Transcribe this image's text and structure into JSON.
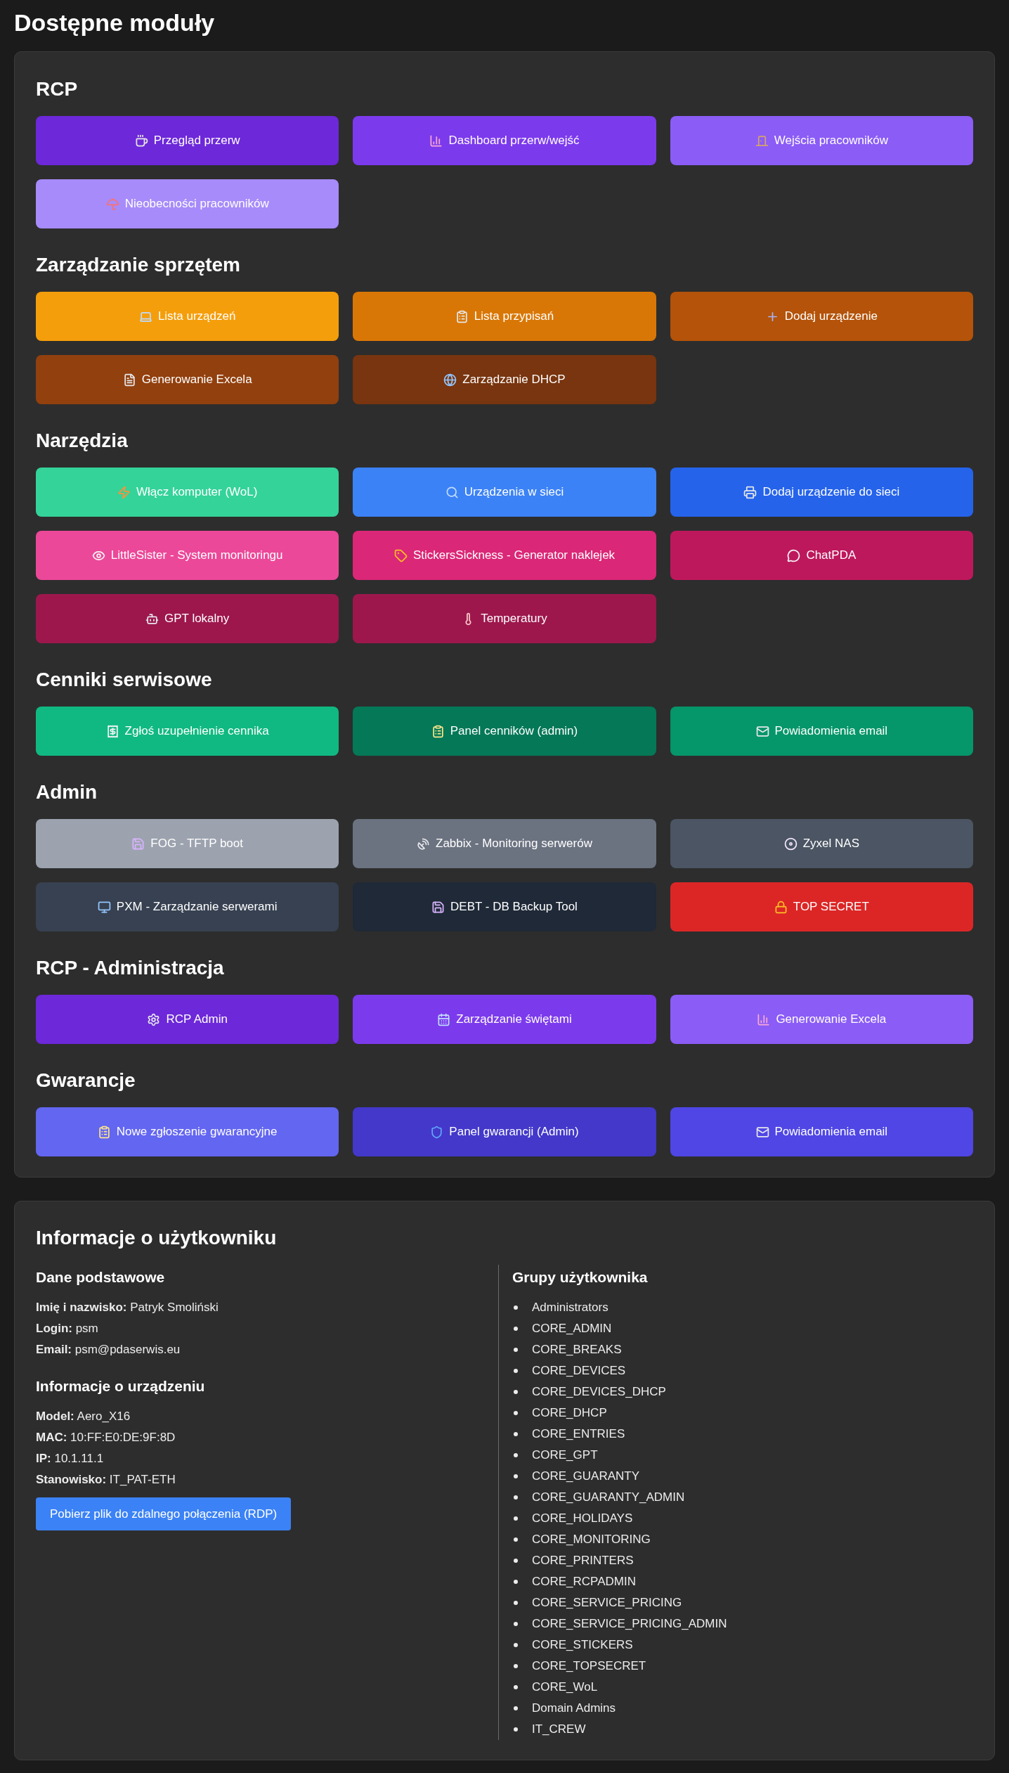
{
  "page_title": "Dostępne moduły",
  "sections": [
    {
      "title": "RCP",
      "buttons": [
        {
          "label": "Przegląd przerw",
          "color": "#6d28d9"
        },
        {
          "label": "Dashboard przerw/wejść",
          "color": "#7c3aed"
        },
        {
          "label": "Wejścia pracowników",
          "color": "#8b5cf6"
        },
        {
          "label": "Nieobecności pracowników",
          "color": "#a78bfa"
        }
      ]
    },
    {
      "title": "Zarządzanie sprzętem",
      "buttons": [
        {
          "label": "Lista urządzeń",
          "color": "#f59e0b"
        },
        {
          "label": "Lista przypisań",
          "color": "#d97706"
        },
        {
          "label": "Dodaj urządzenie",
          "color": "#b45309"
        },
        {
          "label": "Generowanie Excela",
          "color": "#92400e"
        },
        {
          "label": "Zarządzanie DHCP",
          "color": "#78350f"
        }
      ]
    },
    {
      "title": "Narzędzia",
      "buttons": [
        {
          "label": "Włącz komputer (WoL)",
          "color": "#34d399"
        },
        {
          "label": "Urządzenia w sieci",
          "color": "#3b82f6"
        },
        {
          "label": "Dodaj urządzenie do sieci",
          "color": "#2563eb"
        },
        {
          "label": "LittleSister - System monitoringu",
          "color": "#ec4899"
        },
        {
          "label": "StickersSickness - Generator naklejek",
          "color": "#db2777"
        },
        {
          "label": "ChatPDA",
          "color": "#be185d"
        },
        {
          "label": "GPT lokalny",
          "color": "#9d174d"
        },
        {
          "label": "Temperatury",
          "color": "#9d174d"
        }
      ]
    },
    {
      "title": "Cenniki serwisowe",
      "buttons": [
        {
          "label": "Zgłoś uzupełnienie cennika",
          "color": "#10b981"
        },
        {
          "label": "Panel cenników (admin)",
          "color": "#047857"
        },
        {
          "label": "Powiadomienia email",
          "color": "#059669"
        }
      ]
    },
    {
      "title": "Admin",
      "buttons": [
        {
          "label": "FOG - TFTP boot",
          "color": "#9ca3af"
        },
        {
          "label": "Zabbix - Monitoring serwerów",
          "color": "#6b7280"
        },
        {
          "label": "Zyxel NAS",
          "color": "#4b5563"
        },
        {
          "label": "PXM - Zarządzanie serwerami",
          "color": "#374151"
        },
        {
          "label": "DEBT - DB Backup Tool",
          "color": "#1f2937"
        },
        {
          "label": "TOP SECRET",
          "color": "#dc2626"
        }
      ]
    },
    {
      "title": "RCP - Administracja",
      "buttons": [
        {
          "label": "RCP Admin",
          "color": "#6d28d9"
        },
        {
          "label": "Zarządzanie świętami",
          "color": "#7c3aed"
        },
        {
          "label": "Generowanie Excela",
          "color": "#8b5cf6"
        }
      ]
    },
    {
      "title": "Gwarancje",
      "buttons": [
        {
          "label": "Nowe zgłoszenie gwarancyjne",
          "color": "#6366f1"
        },
        {
          "label": "Panel gwarancji (Admin)",
          "color": "#4338ca"
        },
        {
          "label": "Powiadomienia email",
          "color": "#4f46e5"
        }
      ]
    }
  ],
  "user_info": {
    "title": "Informacje o użytkowniku",
    "basic": {
      "title": "Dane podstawowe",
      "lines": [
        "**Imię i nazwisko:** Patryk Smoliński",
        "**Login:** psm",
        "**Email:** psm@pdaserwis.eu"
      ]
    },
    "device": {
      "title": "Informacje o urządzeniu",
      "lines": [
        "**Model:** Aero_X16",
        "**MAC:** 10:FF:E0:DE:9F:8D",
        "**IP:** 10.1.11.1",
        "**Stanowisko:** IT_PAT-ETH"
      ]
    },
    "rdp_button": "Pobierz plik do zdalnego połączenia (RDP)",
    "groups": {
      "title": "Grupy użytkownika",
      "items": [
        "Administrators",
        "CORE_ADMIN",
        "CORE_BREAKS",
        "CORE_DEVICES",
        "CORE_DEVICES_DHCP",
        "CORE_DHCP",
        "CORE_ENTRIES",
        "CORE_GPT",
        "CORE_GUARANTY",
        "CORE_GUARANTY_ADMIN",
        "CORE_HOLIDAYS",
        "CORE_MONITORING",
        "CORE_PRINTERS",
        "CORE_RCPADMIN",
        "CORE_SERVICE_PRICING",
        "CORE_SERVICE_PRICING_ADMIN",
        "CORE_STICKERS",
        "CORE_TOPSECRET",
        "CORE_WoL",
        "Domain Admins",
        "IT_CREW"
      ]
    }
  }
}
